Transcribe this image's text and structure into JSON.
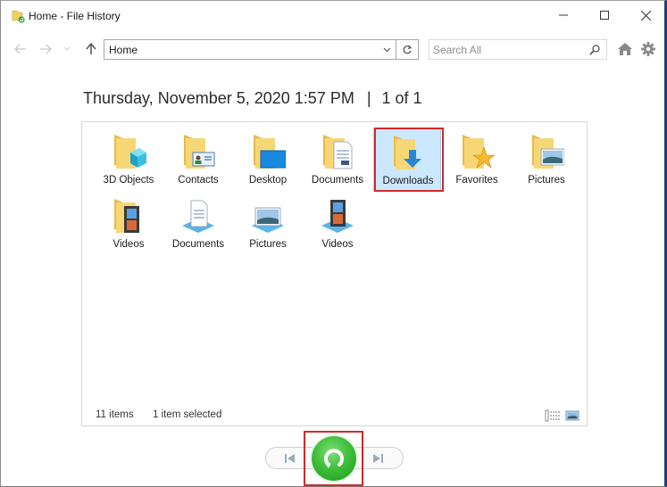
{
  "window": {
    "title": "Home - File History",
    "controls": {
      "minimize": "minimize",
      "maximize": "maximize",
      "close": "close"
    }
  },
  "navigation": {
    "back_icon": "arrow-left-icon",
    "forward_icon": "arrow-right-icon",
    "recent_icon": "chevron-down-icon",
    "up_icon": "arrow-up-icon",
    "address": "Home",
    "search_placeholder": "Search All"
  },
  "header": {
    "datetime": "Thursday, November 5, 2020 1:57 PM",
    "separator": "|",
    "page_position": "1 of 1"
  },
  "items": [
    {
      "label": "3D Objects",
      "icon": "folder-3d-objects-icon",
      "selected": false
    },
    {
      "label": "Contacts",
      "icon": "folder-contacts-icon",
      "selected": false
    },
    {
      "label": "Desktop",
      "icon": "folder-desktop-icon",
      "selected": false
    },
    {
      "label": "Documents",
      "icon": "folder-documents-icon",
      "selected": false
    },
    {
      "label": "Downloads",
      "icon": "folder-downloads-icon",
      "selected": true
    },
    {
      "label": "Favorites",
      "icon": "folder-favorites-icon",
      "selected": false
    },
    {
      "label": "Pictures",
      "icon": "folder-pictures-icon",
      "selected": false
    },
    {
      "label": "Videos",
      "icon": "folder-videos-icon",
      "selected": false
    },
    {
      "label": "Documents",
      "icon": "library-documents-icon",
      "selected": false
    },
    {
      "label": "Pictures",
      "icon": "library-pictures-icon",
      "selected": false
    },
    {
      "label": "Videos",
      "icon": "library-videos-icon",
      "selected": false
    }
  ],
  "status": {
    "item_count": "11 items",
    "selection": "1 item selected"
  },
  "playback": {
    "previous_label": "Previous version",
    "restore_label": "Restore to original location",
    "next_label": "Next version"
  },
  "colors": {
    "selection_bg": "#cce8ff",
    "highlight_border": "#d02a2a",
    "restore_green": "#3fbf3a",
    "folder_yellow": "#f5d36c"
  }
}
